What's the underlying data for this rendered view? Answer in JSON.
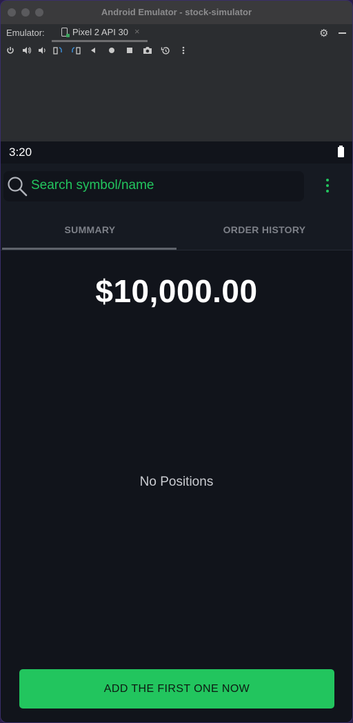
{
  "window": {
    "title": "Android Emulator - stock-simulator"
  },
  "emulator": {
    "label": "Emulator:",
    "device_tab": "Pixel 2 API 30",
    "close_glyph": "×"
  },
  "toolbar": {
    "icons": [
      "power-icon",
      "volume-up-icon",
      "volume-down-icon",
      "rotate-left-icon",
      "rotate-right-icon",
      "back-icon",
      "home-icon",
      "overview-icon",
      "camera-icon",
      "snapshot-icon",
      "more-icon"
    ]
  },
  "phone": {
    "status_time": "3:20",
    "search_placeholder": "Search symbol/name",
    "tabs": [
      {
        "label": "SUMMARY",
        "selected": true
      },
      {
        "label": "ORDER HISTORY",
        "selected": false
      }
    ],
    "balance": "$10,000.00",
    "empty_message": "No Positions",
    "cta_label": "ADD THE FIRST ONE NOW"
  },
  "colors": {
    "accent": "#22c55e",
    "background": "#11141b",
    "appbar": "#161a22"
  }
}
